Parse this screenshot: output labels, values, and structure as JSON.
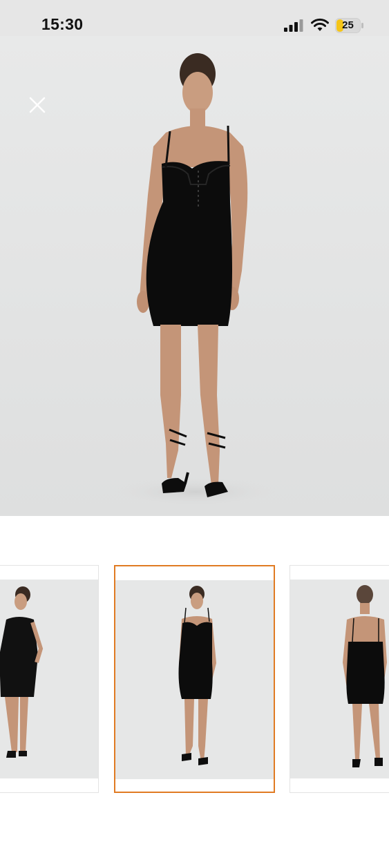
{
  "status_bar": {
    "time": "15:30",
    "battery_level": "25",
    "icons": [
      "signal-icon",
      "wifi-icon",
      "battery-icon"
    ],
    "battery_color": "#f5c518"
  },
  "viewer": {
    "close_icon": "close-icon",
    "main_image_alt": "black-dress-front-view"
  },
  "gallery": {
    "thumbnails": [
      {
        "view": "side",
        "selected": false
      },
      {
        "view": "front",
        "selected": true
      },
      {
        "view": "back",
        "selected": false
      }
    ],
    "selected_index": 1,
    "accent_color": "#e07a22"
  }
}
